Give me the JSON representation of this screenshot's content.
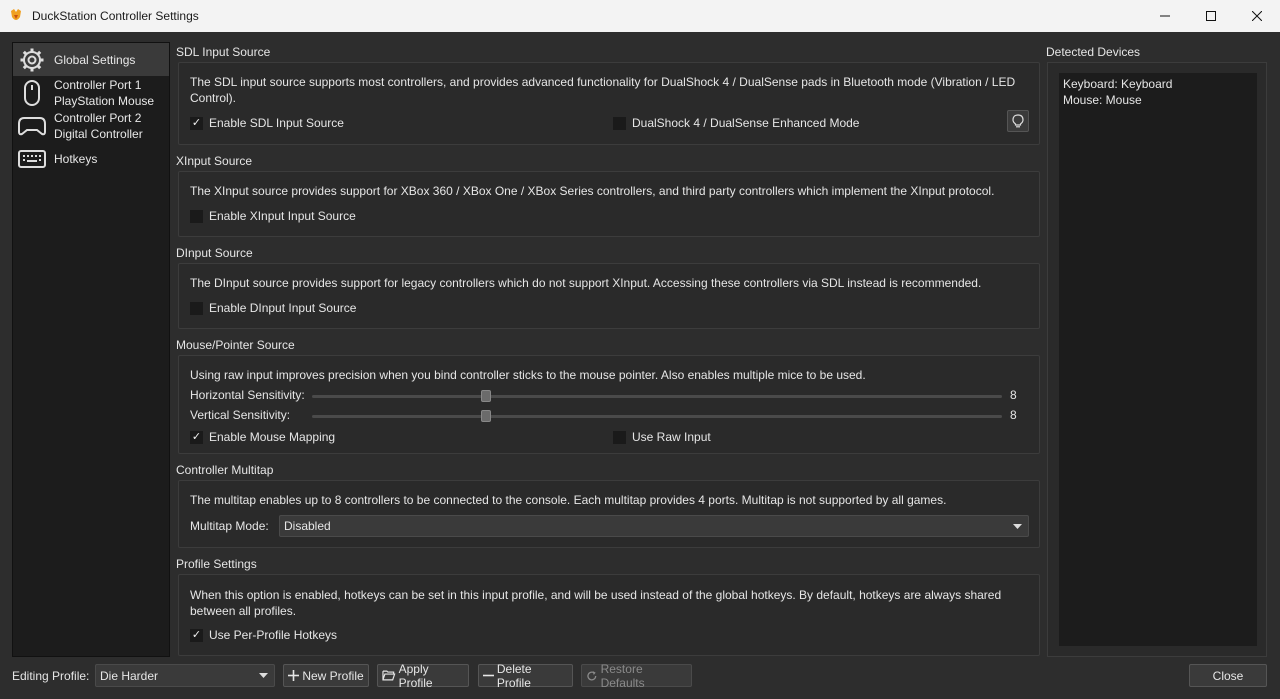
{
  "window": {
    "title": "DuckStation Controller Settings"
  },
  "sidebar": {
    "items": [
      {
        "label": "Global Settings",
        "icon": "gear-icon"
      },
      {
        "label": "Controller Port 1",
        "sublabel": "PlayStation Mouse",
        "icon": "mouse-icon"
      },
      {
        "label": "Controller Port 2",
        "sublabel": "Digital Controller",
        "icon": "gamepad-icon"
      },
      {
        "label": "Hotkeys",
        "icon": "keyboard-icon"
      }
    ]
  },
  "sdl": {
    "title": "SDL Input Source",
    "desc": "The SDL input source supports most controllers, and provides advanced functionality for DualShock 4 / DualSense pads in Bluetooth mode (Vibration / LED",
    "desc2": "Control).",
    "enable_label": "Enable SDL Input Source",
    "enable_checked": true,
    "enhanced_label": "DualShock 4 / DualSense Enhanced Mode",
    "enhanced_checked": false
  },
  "xinput": {
    "title": "XInput Source",
    "desc": "The XInput source provides support for XBox 360 / XBox One / XBox Series controllers, and third party controllers which implement the XInput protocol.",
    "enable_label": "Enable XInput Input Source",
    "enable_checked": false
  },
  "dinput": {
    "title": "DInput Source",
    "desc": "The DInput source provides support for legacy controllers which do not support XInput. Accessing these controllers via SDL instead is recommended.",
    "enable_label": "Enable DInput Input Source",
    "enable_checked": false
  },
  "mouse": {
    "title": "Mouse/Pointer Source",
    "desc": "Using raw input improves precision when you bind controller sticks to the mouse pointer. Also enables multiple mice to be used.",
    "horizontal_label": "Horizontal Sensitivity:",
    "horizontal_value": "8",
    "horizontal_fraction": 0.245,
    "vertical_label": "Vertical Sensitivity:",
    "vertical_value": "8",
    "vertical_fraction": 0.245,
    "mapping_label": "Enable Mouse Mapping",
    "mapping_checked": true,
    "raw_label": "Use Raw Input",
    "raw_checked": false
  },
  "multitap": {
    "title": "Controller Multitap",
    "desc": "The multitap enables up to 8 controllers to be connected to the console. Each multitap provides 4 ports. Multitap is not supported by all games.",
    "mode_label": "Multitap Mode:",
    "mode_value": "Disabled"
  },
  "profile": {
    "title": "Profile Settings",
    "desc": "When this option is enabled, hotkeys can be set in this input profile, and will be used instead of the global hotkeys. By default, hotkeys are always shared",
    "desc2": "between all profiles.",
    "hotkeys_label": "Use Per-Profile Hotkeys",
    "hotkeys_checked": true
  },
  "devices": {
    "title": "Detected Devices",
    "items": [
      "Keyboard: Keyboard",
      "Mouse: Mouse"
    ]
  },
  "bottom": {
    "editing_label": "Editing Profile:",
    "profile_value": "Die Harder",
    "new_label": "New Profile",
    "apply_label": "Apply Profile",
    "delete_label": "Delete Profile",
    "restore_label": "Restore Defaults",
    "close_label": "Close"
  }
}
